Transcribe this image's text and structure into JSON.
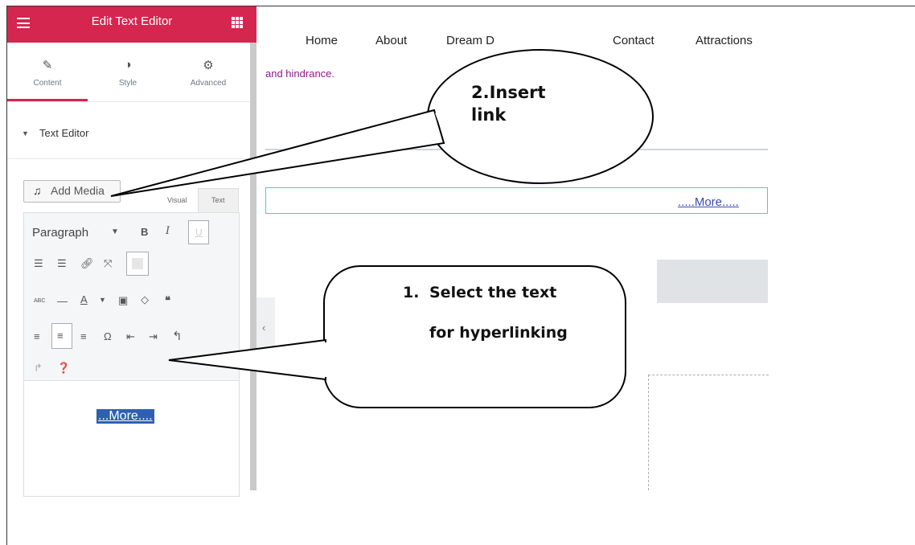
{
  "panel": {
    "title": "Edit Text Editor",
    "tabs": [
      {
        "label": "Content",
        "icon": "pencil-icon"
      },
      {
        "label": "Style",
        "icon": "contrast-icon"
      },
      {
        "label": "Advanced",
        "icon": "gear-icon"
      }
    ],
    "section": "Text Editor",
    "add_media": "Add Media",
    "editor_modes": {
      "visual": "Visual",
      "text": "Text"
    },
    "format_select": "Paragraph",
    "selected_text": "...More...."
  },
  "site": {
    "nav": [
      "Home",
      "About",
      "Dream D",
      "Contact",
      "Attractions"
    ],
    "body_text": "and hindrance.",
    "more_link": ".....More....."
  },
  "callouts": {
    "insert": {
      "line1": "2.Insert",
      "line2": "link"
    },
    "select": {
      "number": "1.",
      "line1": "Select the text",
      "line2": "for hyperlinking"
    }
  },
  "colors": {
    "brand": "#d5264f",
    "link": "#3a4ab0",
    "selection": "#2f5fb0",
    "highlight_border": "#5bc0de"
  }
}
